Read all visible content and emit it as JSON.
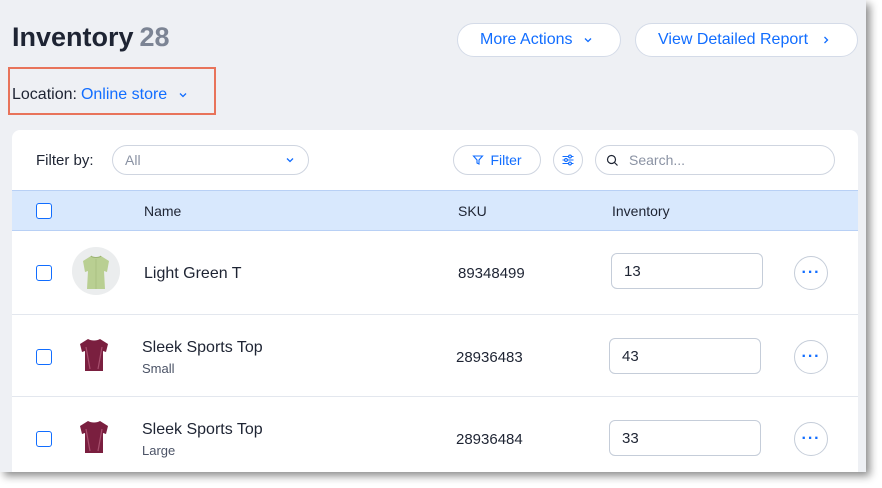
{
  "header": {
    "title": "Inventory",
    "count": "28",
    "more_actions_label": "More Actions",
    "view_report_label": "View Detailed Report"
  },
  "location": {
    "label": "Location:",
    "value": "Online store"
  },
  "toolbar": {
    "filter_by_label": "Filter by:",
    "filter_select_value": "All",
    "filter_button_label": "Filter",
    "search_placeholder": "Search..."
  },
  "table": {
    "columns": [
      "Name",
      "SKU",
      "Inventory"
    ],
    "rows": [
      {
        "name": "Light Green T",
        "variant": "",
        "sku": "89348499",
        "inventory": "13",
        "thumb": "green-shirt"
      },
      {
        "name": "Sleek Sports Top",
        "variant": "Small",
        "sku": "28936483",
        "inventory": "43",
        "thumb": "maroon-top"
      },
      {
        "name": "Sleek Sports Top",
        "variant": "Large",
        "sku": "28936484",
        "inventory": "33",
        "thumb": "maroon-top"
      }
    ]
  },
  "colors": {
    "accent": "#116dff",
    "header_row_bg": "#d8e8fd",
    "highlight_box": "#e8735a",
    "page_bg": "#eef0f4"
  }
}
